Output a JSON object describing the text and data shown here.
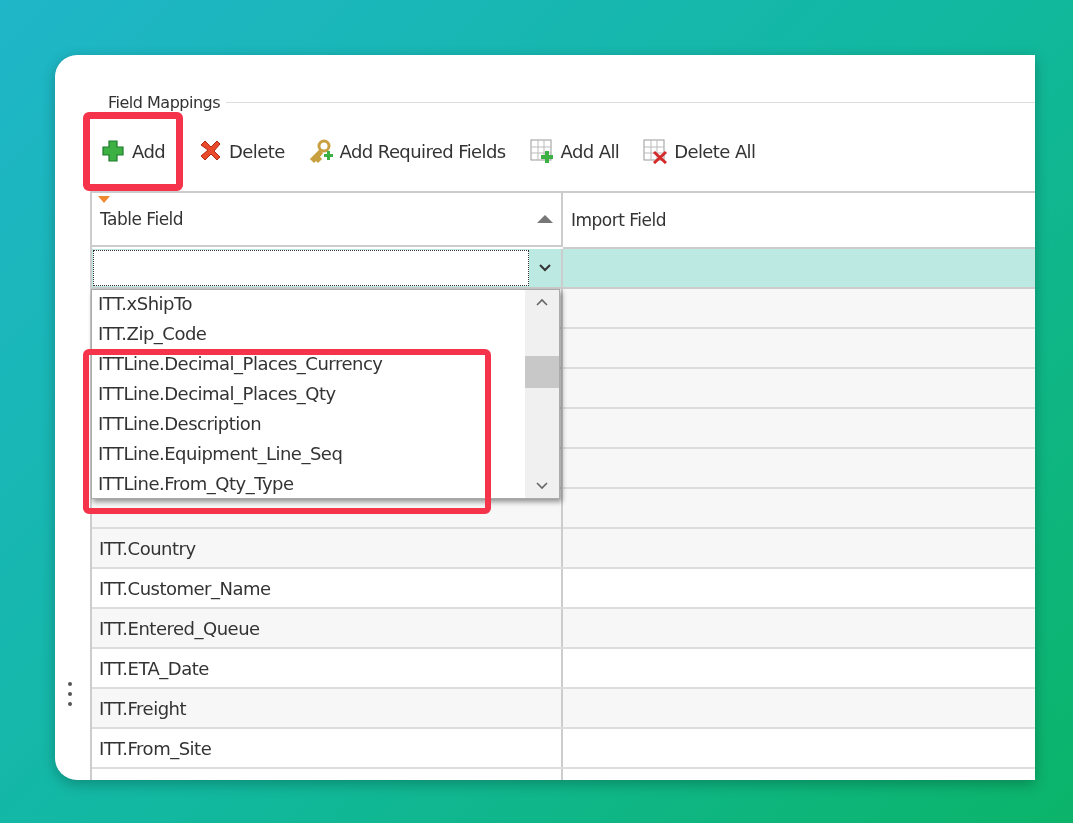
{
  "group": {
    "title": "Field Mappings"
  },
  "toolbar": [
    {
      "label": "Add",
      "highlighted": true
    },
    {
      "label": "Delete",
      "highlighted": false
    },
    {
      "label": "Add Required Fields",
      "highlighted": false
    },
    {
      "label": "Add All",
      "highlighted": false
    },
    {
      "label": "Delete All",
      "highlighted": false
    }
  ],
  "table": {
    "columns": [
      {
        "label": "Table Field",
        "sorted": true,
        "filter": true
      },
      {
        "label": "Import Field",
        "sorted": false,
        "filter": false
      }
    ],
    "rows": [
      {
        "table_field": "ITT.Country"
      },
      {
        "table_field": "ITT.Customer_Name"
      },
      {
        "table_field": "ITT.Entered_Queue"
      },
      {
        "table_field": "ITT.ETA_Date"
      },
      {
        "table_field": "ITT.Freight"
      },
      {
        "table_field": "ITT.From_Site"
      }
    ]
  },
  "dropdown": {
    "items": [
      {
        "label": "ITT.xShipTo",
        "highlighted": false
      },
      {
        "label": "ITT.Zip_Code",
        "highlighted": false
      },
      {
        "label": "ITTLine.Decimal_Places_Currency",
        "highlighted": true
      },
      {
        "label": "ITTLine.Decimal_Places_Qty",
        "highlighted": true
      },
      {
        "label": "ITTLine.Description",
        "highlighted": true
      },
      {
        "label": "ITTLine.Equipment_Line_Seq",
        "highlighted": true
      },
      {
        "label": "ITTLine.From_Qty_Type",
        "highlighted": true
      }
    ]
  }
}
